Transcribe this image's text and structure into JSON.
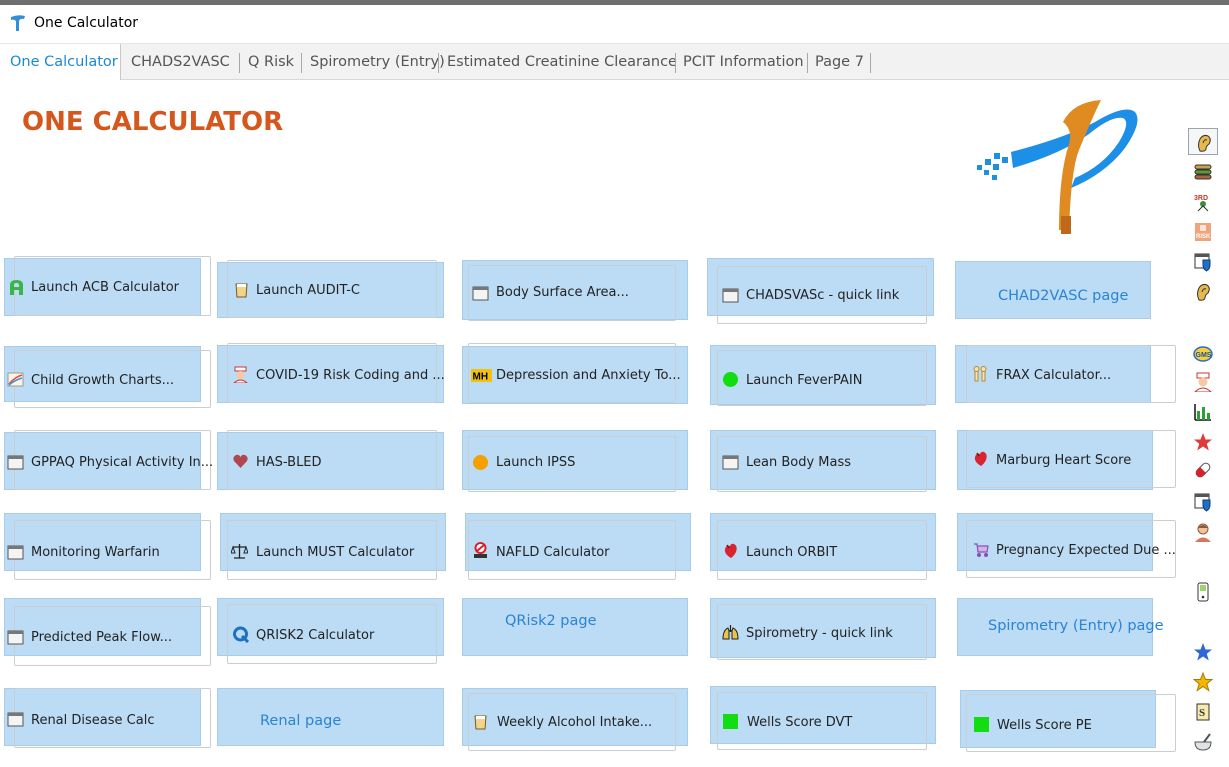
{
  "window": {
    "title": "One Calculator"
  },
  "tabs": [
    {
      "label": "One Calculator"
    },
    {
      "label": "CHADS2VASC"
    },
    {
      "label": "Q Risk"
    },
    {
      "label": "Spirometry (Entry)"
    },
    {
      "label": "Estimated Creatinine Clearance"
    },
    {
      "label": "PCIT Information"
    },
    {
      "label": "Page 7"
    }
  ],
  "heading": "ONE CALCULATOR",
  "buttons": [
    {
      "label": "Launch ACB Calculator",
      "icon": "acb-letter-icon"
    },
    {
      "label": "Launch AUDIT-C",
      "icon": "beer-glass-icon"
    },
    {
      "label": "Body Surface Area...",
      "icon": "window-icon"
    },
    {
      "label": "CHADSVASc  - quick link",
      "icon": "window-icon"
    },
    {
      "label": "CHAD2VASC page",
      "icon": ""
    },
    {
      "label": "Child Growth Charts...",
      "icon": "growth-chart-icon"
    },
    {
      "label": "COVID-19 Risk Coding and ...",
      "icon": "nurse-icon"
    },
    {
      "label": "Depression and Anxiety To...",
      "icon": "mh-badge-icon"
    },
    {
      "label": "Launch FeverPAIN",
      "icon": "green-dot-icon"
    },
    {
      "label": "FRAX Calculator...",
      "icon": "bones-icon"
    },
    {
      "label": "GPPAQ Physical Activity In...",
      "icon": "window-icon"
    },
    {
      "label": "HAS-BLED",
      "icon": "heart-icon"
    },
    {
      "label": "Launch IPSS",
      "icon": "orange-dot-icon"
    },
    {
      "label": "Lean Body Mass",
      "icon": "window-icon"
    },
    {
      "label": "Marburg Heart Score",
      "icon": "heart-organ-icon"
    },
    {
      "label": "Monitoring Warfarin",
      "icon": "window-icon"
    },
    {
      "label": "Launch MUST Calculator",
      "icon": "scales-icon"
    },
    {
      "label": "NAFLD Calculator",
      "icon": "no-entry-icon"
    },
    {
      "label": "Launch ORBIT",
      "icon": "heart-organ-icon"
    },
    {
      "label": "Pregnancy Expected Due ...",
      "icon": "pram-icon"
    },
    {
      "label": "Predicted Peak Flow...",
      "icon": "window-icon"
    },
    {
      "label": "QRISK2 Calculator",
      "icon": "qrisk-q-icon"
    },
    {
      "label": "QRisk2 page",
      "icon": ""
    },
    {
      "label": "Spirometry - quick link",
      "icon": "lungs-icon"
    },
    {
      "label": "Spirometry (Entry) page",
      "icon": ""
    },
    {
      "label": "Renal Disease Calc",
      "icon": "window-icon"
    },
    {
      "label": "Renal page",
      "icon": ""
    },
    {
      "label": "Weekly Alcohol Intake...",
      "icon": "beer-glass-icon"
    },
    {
      "label": "Wells Score DVT",
      "icon": "green-square-icon"
    },
    {
      "label": "Wells Score PE",
      "icon": "green-square-icon"
    }
  ],
  "sidebar_icons": [
    "ear-icon",
    "stack-icon",
    "3rd-party-icon",
    "risk-icon",
    "shield-window-icon",
    "ear-icon",
    "gms-icon",
    "nurse-icon",
    "bar-chart-icon",
    "red-star-icon",
    "pill-icon",
    "shield-window-icon",
    "person-icon",
    "phone-icon",
    "blue-star-icon",
    "gold-star-icon",
    "scroll-icon",
    "mortar-icon"
  ],
  "colors": {
    "heading": "#d4571d",
    "accent": "#1a8ad6",
    "tile": "#bcdcf5",
    "link": "#2a83d4"
  }
}
